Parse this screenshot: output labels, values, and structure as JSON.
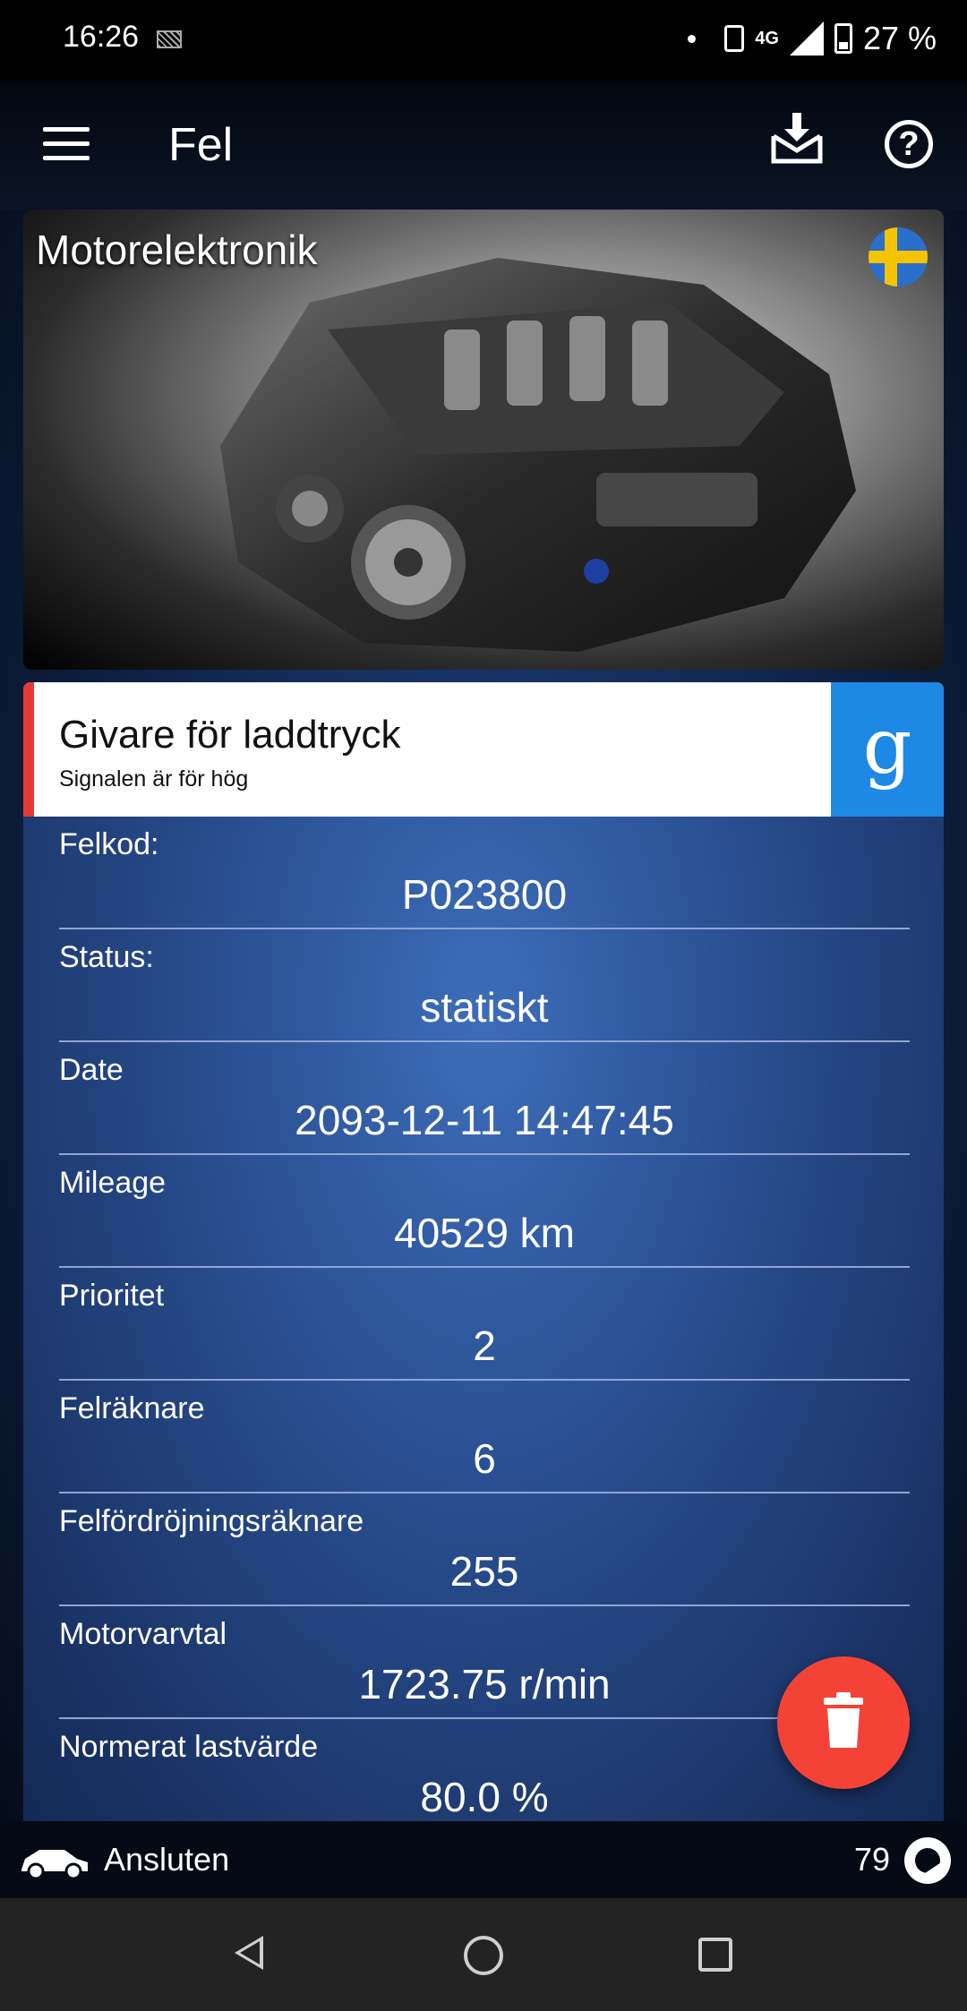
{
  "status_bar": {
    "time": "16:26",
    "network": "4G",
    "battery": "27 %"
  },
  "app_bar": {
    "title": "Fel",
    "icons": [
      "menu-icon",
      "download-icon",
      "help-icon"
    ]
  },
  "header_card": {
    "title": "Motorelektronik",
    "flag": "sweden"
  },
  "fault": {
    "title": "Givare för laddtryck",
    "subtitle": "Signalen är för hög",
    "search_button": "g"
  },
  "details": [
    {
      "label": "Felkod:",
      "value": "P023800"
    },
    {
      "label": "Status:",
      "value": "statiskt"
    },
    {
      "label": "Date",
      "value": "2093-12-11 14:47:45"
    },
    {
      "label": "Mileage",
      "value": "40529 km"
    },
    {
      "label": "Prioritet",
      "value": "2"
    },
    {
      "label": "Felräknare",
      "value": "6"
    },
    {
      "label": "Felfördröjningsräknare",
      "value": "255"
    },
    {
      "label": "Motorvarvtal",
      "value": "1723.75 r/min"
    },
    {
      "label": "Normerat lastvärde",
      "value": "80.0 %"
    }
  ],
  "bottom_status": {
    "connection": "Ansluten",
    "count": "79"
  },
  "colors": {
    "accent_red": "#e53935",
    "google_blue": "#1e88e5",
    "fab_red": "#f44336",
    "panel_blue": "#2a4f92"
  }
}
